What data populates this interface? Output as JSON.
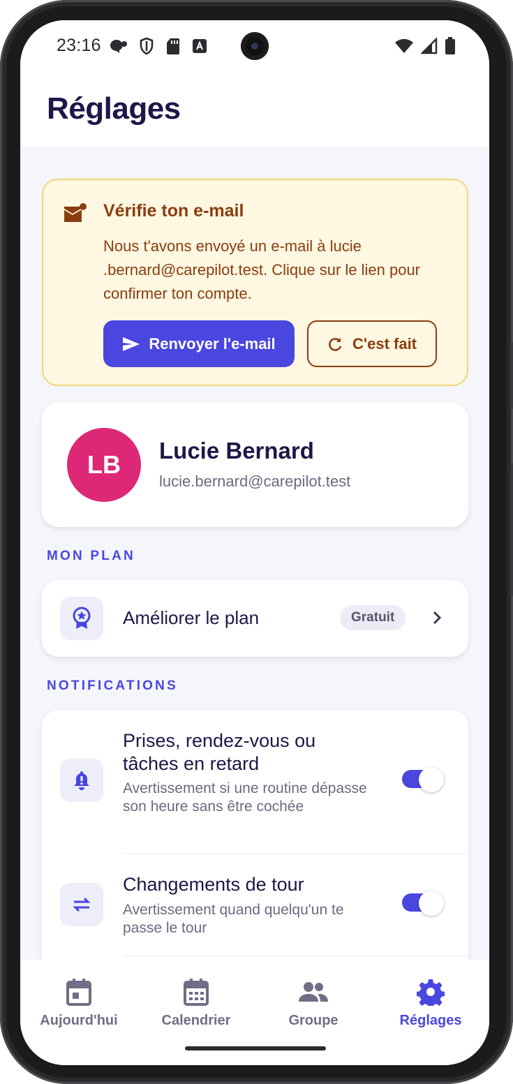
{
  "status_bar": {
    "time": "23:16",
    "icons_left": [
      "message-badge-icon",
      "shield-icon",
      "sd-card-icon",
      "keyboard-a-icon"
    ],
    "icons_right": [
      "wifi-icon",
      "signal-icon",
      "battery-icon"
    ]
  },
  "header": {
    "title": "Réglages"
  },
  "verify_email": {
    "title": "Vérifie ton e-mail",
    "body": "Nous t'avons envoyé un e-mail à lucie .bernard@carepilot.test. Clique sur le lien pour confirmer ton compte.",
    "resend_label": "Renvoyer l'e-mail",
    "done_label": "C'est fait",
    "colors": {
      "background": "#fef7e1",
      "border": "#f1d679",
      "text": "#8a3d10"
    }
  },
  "profile": {
    "initials": "LB",
    "name": "Lucie Bernard",
    "email": "lucie.bernard@carepilot.test",
    "avatar_color": "#dc2876"
  },
  "plan_section": {
    "label": "MON PLAN",
    "item_label": "Améliorer le plan",
    "badge": "Gratuit"
  },
  "notifications_section": {
    "label": "NOTIFICATIONS",
    "items": [
      {
        "title_line1": "Prises, rendez-vous ou",
        "title_line2": "tâches en retard",
        "description": "Avertissement si une routine dépasse son heure sans être cochée",
        "enabled": true,
        "icon": "bell-icon"
      },
      {
        "title_line1": "Changements de tour",
        "description": "Avertissement quand quelqu'un te passe le tour",
        "enabled": true,
        "icon": "swap-arrows-icon"
      }
    ]
  },
  "bottom_nav": {
    "items": [
      {
        "label": "Aujourd'hui",
        "icon": "calendar-today-icon",
        "active": false
      },
      {
        "label": "Calendrier",
        "icon": "calendar-month-icon",
        "active": false
      },
      {
        "label": "Groupe",
        "icon": "group-icon",
        "active": false
      },
      {
        "label": "Réglages",
        "icon": "gear-icon",
        "active": true
      }
    ]
  },
  "colors": {
    "accent": "#4a46e0",
    "title": "#1c1848",
    "muted": "#6a6a80"
  }
}
